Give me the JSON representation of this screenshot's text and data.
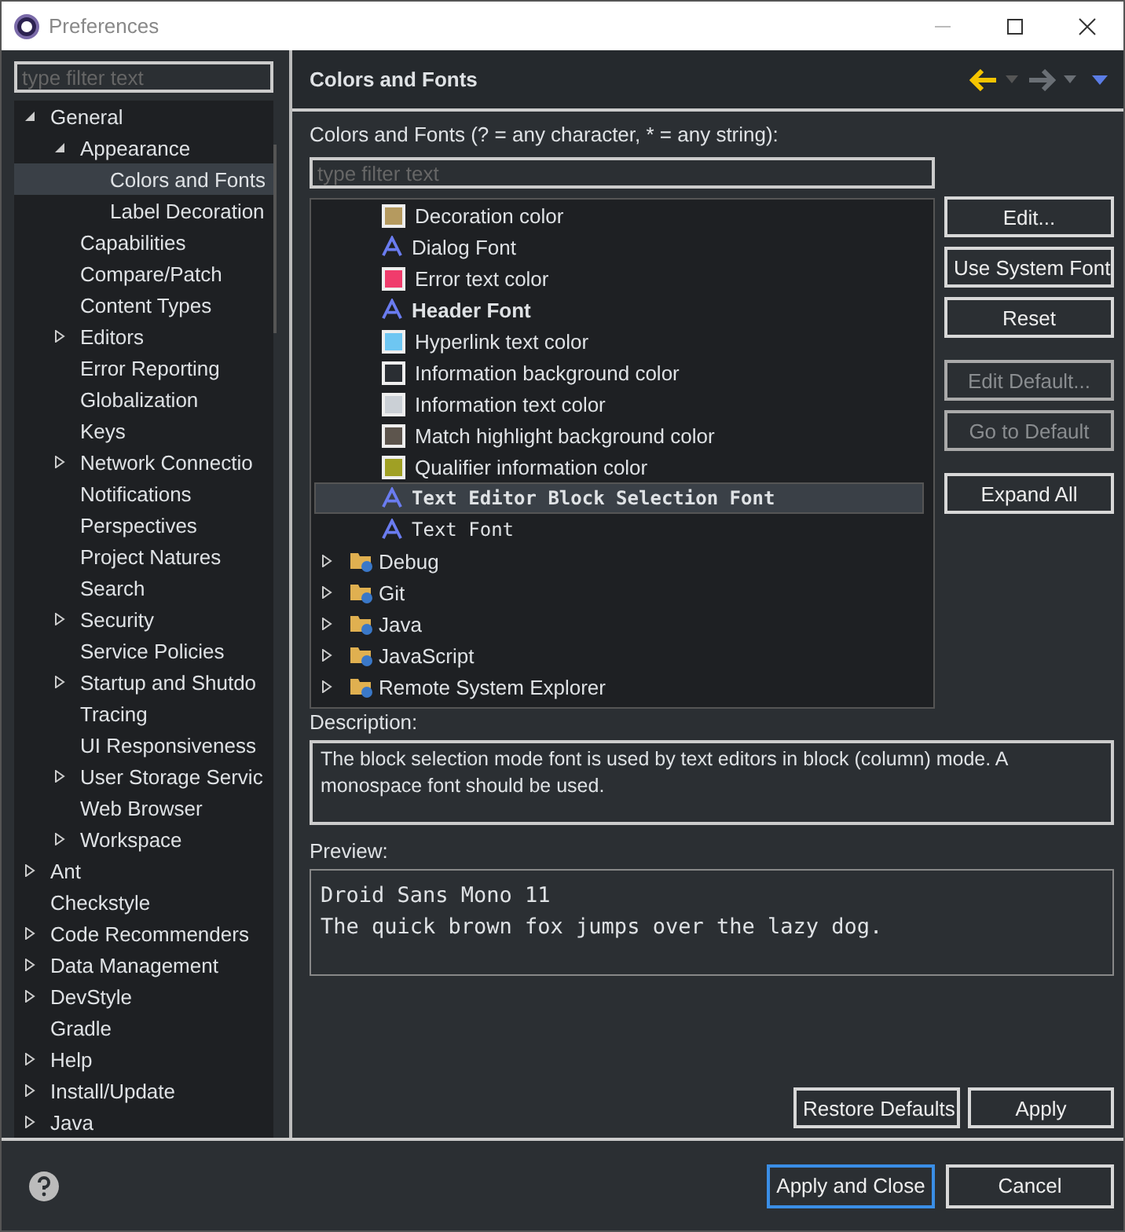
{
  "window": {
    "title": "Preferences"
  },
  "sidebar": {
    "filter": {
      "placeholder": "type filter text"
    },
    "items": [
      {
        "label": "General",
        "expanded": true,
        "selected": false,
        "children": [
          {
            "label": "Appearance",
            "expanded": true,
            "selected": false,
            "children": [
              {
                "label": "Colors and Fonts",
                "selected": true
              },
              {
                "label": "Label Decoration",
                "selected": false
              }
            ]
          },
          {
            "label": "Capabilities",
            "selected": false
          },
          {
            "label": "Compare/Patch",
            "selected": false
          },
          {
            "label": "Content Types",
            "selected": false
          },
          {
            "label": "Editors",
            "expanded": false,
            "selected": false
          },
          {
            "label": "Error Reporting",
            "selected": false
          },
          {
            "label": "Globalization",
            "selected": false
          },
          {
            "label": "Keys",
            "selected": false
          },
          {
            "label": "Network Connectio",
            "expanded": false,
            "selected": false
          },
          {
            "label": "Notifications",
            "selected": false
          },
          {
            "label": "Perspectives",
            "selected": false
          },
          {
            "label": "Project Natures",
            "selected": false
          },
          {
            "label": "Search",
            "selected": false
          },
          {
            "label": "Security",
            "expanded": false,
            "selected": false
          },
          {
            "label": "Service Policies",
            "selected": false
          },
          {
            "label": "Startup and Shutdo",
            "expanded": false,
            "selected": false
          },
          {
            "label": "Tracing",
            "selected": false
          },
          {
            "label": "UI Responsiveness",
            "selected": false
          },
          {
            "label": "User Storage Servic",
            "expanded": false,
            "selected": false
          },
          {
            "label": "Web Browser",
            "selected": false
          },
          {
            "label": "Workspace",
            "expanded": false,
            "selected": false
          }
        ]
      },
      {
        "label": "Ant",
        "expanded": false,
        "selected": false
      },
      {
        "label": "Checkstyle",
        "selected": false
      },
      {
        "label": "Code Recommenders",
        "expanded": false,
        "selected": false
      },
      {
        "label": "Data Management",
        "expanded": false,
        "selected": false
      },
      {
        "label": "DevStyle",
        "expanded": false,
        "selected": false
      },
      {
        "label": "Gradle",
        "selected": false
      },
      {
        "label": "Help",
        "expanded": false,
        "selected": false
      },
      {
        "label": "Install/Update",
        "expanded": false,
        "selected": false
      },
      {
        "label": "Java",
        "expanded": false,
        "selected": false
      }
    ]
  },
  "page": {
    "title": "Colors and Fonts",
    "filter_label": "Colors and Fonts (? = any character, * = any string):",
    "filter": {
      "placeholder": "type filter text"
    },
    "entries": [
      {
        "kind": "color",
        "label": "Decoration color",
        "color": "#b59a5f",
        "selected": false
      },
      {
        "kind": "font",
        "label": "Dialog Font",
        "selected": false
      },
      {
        "kind": "color",
        "label": "Error text color",
        "color": "#f03c6c",
        "selected": false
      },
      {
        "kind": "bold-font",
        "label": "Header Font",
        "selected": false
      },
      {
        "kind": "color",
        "label": "Hyperlink text color",
        "color": "#6ec6f2",
        "selected": false
      },
      {
        "kind": "color",
        "label": "Information background color",
        "color": "#2a2e33",
        "selected": false
      },
      {
        "kind": "color",
        "label": "Information text color",
        "color": "#cbd0d6",
        "selected": false
      },
      {
        "kind": "color",
        "label": "Match highlight background color",
        "color": "#5d554d",
        "selected": false
      },
      {
        "kind": "color",
        "label": "Qualifier information color",
        "color": "#a0a024",
        "selected": false
      },
      {
        "kind": "mono-font",
        "label": "Text Editor Block Selection Font",
        "selected": true
      },
      {
        "kind": "mono-font",
        "label": "Text Font",
        "selected": false
      },
      {
        "kind": "category",
        "label": "Debug",
        "expanded": false,
        "selected": false
      },
      {
        "kind": "category",
        "label": "Git",
        "expanded": false,
        "selected": false
      },
      {
        "kind": "category",
        "label": "Java",
        "expanded": false,
        "selected": false
      },
      {
        "kind": "category",
        "label": "JavaScript",
        "expanded": false,
        "selected": false
      },
      {
        "kind": "category",
        "label": "Remote System Explorer",
        "expanded": false,
        "selected": false
      }
    ],
    "side_buttons": [
      {
        "label": "Edit...",
        "disabled": false
      },
      {
        "label": "Use System Font",
        "disabled": false
      },
      {
        "label": "Reset",
        "disabled": false
      },
      {
        "label": "Edit Default...",
        "disabled": true
      },
      {
        "label": "Go to Default",
        "disabled": true
      },
      {
        "label": "Expand All",
        "disabled": false
      }
    ],
    "description_label": "Description:",
    "description": "The block selection mode font is used by text editors in block (column) mode. A monospace font should be used.",
    "preview_label": "Preview:",
    "preview_lines": [
      "Droid Sans Mono 11",
      "The quick brown fox jumps over the lazy dog."
    ],
    "buttons": [
      {
        "label": "Restore Defaults"
      },
      {
        "label": "Apply"
      }
    ]
  },
  "footer": {
    "buttons": [
      {
        "label": "Apply and Close",
        "default": true
      },
      {
        "label": "Cancel",
        "default": false
      }
    ]
  }
}
